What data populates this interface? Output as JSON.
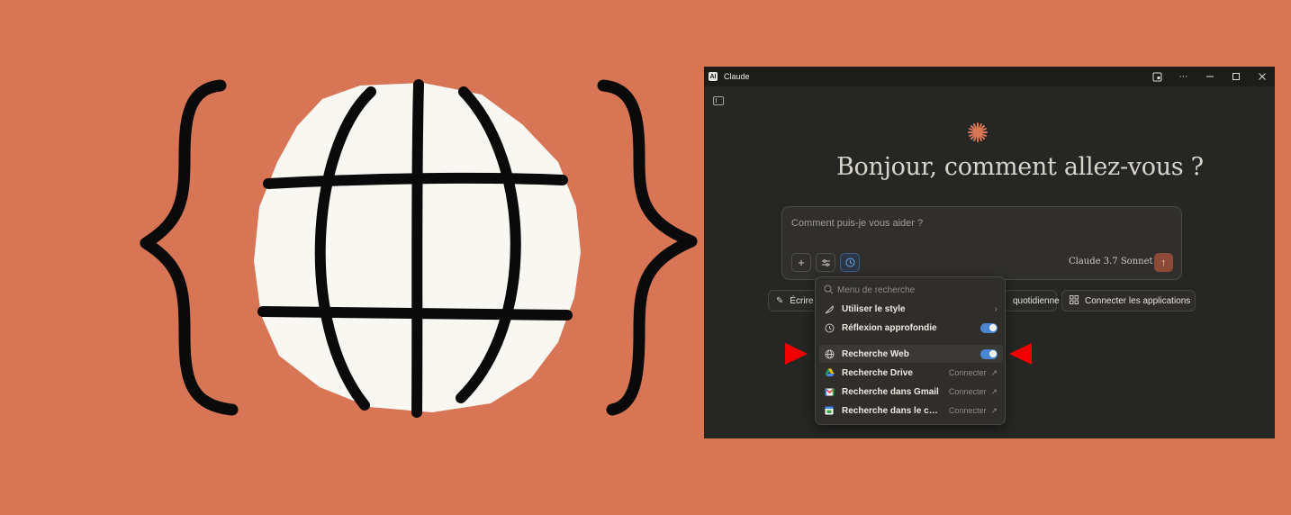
{
  "window": {
    "app_title": "Claude",
    "logo_glyph": "AI",
    "titlebar_icons": [
      "dev-tools-icon",
      "more-icon",
      "minimize-icon",
      "maximize-icon",
      "close-icon"
    ]
  },
  "main": {
    "greeting": "Bonjour, comment allez-vous ?",
    "composer": {
      "placeholder": "Comment puis-je vous aider ?",
      "model": "Claude 3.7 Sonnet",
      "send_glyph": "↑"
    },
    "chips": {
      "write": "Écrire",
      "daily": "quotidienne",
      "apps": "Connecter les applications"
    }
  },
  "menu": {
    "search_placeholder": "Menu de recherche",
    "items": [
      {
        "label": "Utiliser le style",
        "type": "submenu"
      },
      {
        "label": "Réflexion approfondie",
        "type": "toggle",
        "on": true
      },
      {
        "label": "Recherche Web",
        "type": "toggle",
        "on": true
      },
      {
        "label": "Recherche Drive",
        "type": "connect",
        "action": "Connecter"
      },
      {
        "label": "Recherche dans Gmail",
        "type": "connect",
        "action": "Connecter"
      },
      {
        "label": "Recherche dans le calendrier",
        "type": "connect",
        "action": "Connecter"
      }
    ]
  },
  "colors": {
    "background": "#D77555",
    "window": "#262624",
    "accent_blue": "#4A86D1",
    "arrow_red": "#F20000"
  }
}
